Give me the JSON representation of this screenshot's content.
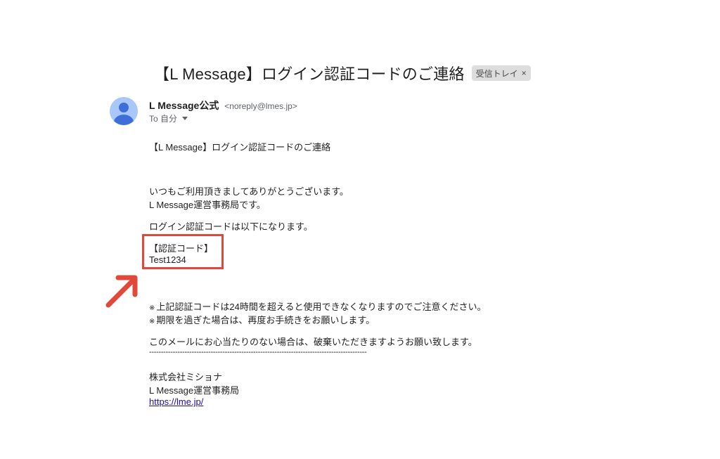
{
  "email": {
    "subject": "【L Message】ログイン認証コードのご連絡",
    "label_chip": "受信トレイ",
    "label_chip_close": "×",
    "sender_name": "L Message公式",
    "sender_email": "<noreply@lmes.jp>",
    "recipient": "To 自分"
  },
  "body": {
    "heading": "【L Message】ログイン認証コードのご連絡",
    "greeting1": "いつもご利用頂きましてありがとうございます。",
    "greeting2": "L Message運営事務局です。",
    "intro": "ログイン認証コードは以下になります。",
    "code_label": "【認証コード】",
    "code_value": "Test1234",
    "note_mark": "※",
    "note1": "上記認証コードは24時間を超えると使用できなくなりますのでご注意ください。",
    "note2": "期限を過ぎた場合は、再度お手続きをお願いします。",
    "closing": "このメールにお心当たりのない場合は、破棄いただきますようお願い致します。",
    "separator": "--------------------------------------------------------------------------------------------",
    "company": "株式会社ミショナ",
    "department": "L Message運営事務局",
    "url": "https://lme.jp/"
  },
  "colors": {
    "highlight": "#e0483a",
    "avatar_bg": "#a8c7fa",
    "avatar_fg": "#3e6fd8",
    "link": "#1a0dab"
  },
  "icons": {
    "avatar": "person-avatar-icon",
    "caret": "chevron-down-icon",
    "arrow": "annotation-arrow-icon"
  }
}
